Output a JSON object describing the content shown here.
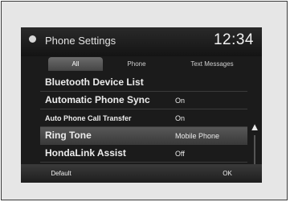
{
  "header": {
    "title": "Phone Settings",
    "clock": "12:34"
  },
  "tabs": [
    {
      "label": "All",
      "active": true
    },
    {
      "label": "Phone",
      "active": false
    },
    {
      "label": "Text Messages",
      "active": false
    }
  ],
  "rows": [
    {
      "label": "Bluetooth Device List",
      "value": ""
    },
    {
      "label": "Automatic Phone Sync",
      "value": "On"
    },
    {
      "label": "Auto Phone Call Transfer",
      "value": "On"
    },
    {
      "label": "Ring Tone",
      "value": "Mobile Phone",
      "selected": true
    },
    {
      "label": "HondaLink Assist",
      "value": "Off"
    }
  ],
  "buttons": {
    "default": "Default",
    "ok": "OK"
  },
  "icons": {
    "header": "phone-settings-icon",
    "scroll_up": "double-chevron-up-icon",
    "scroll_down": "double-chevron-down-icon"
  },
  "colors": {
    "screen_bg": "#1b1b1b",
    "text": "#ececec",
    "selected_row": "#4a4a4a"
  }
}
